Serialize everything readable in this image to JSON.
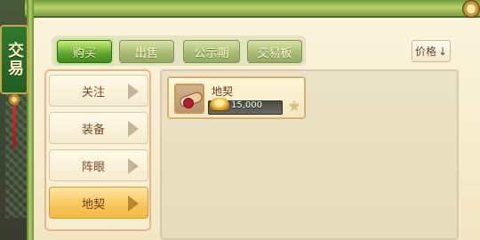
{
  "window": {
    "title": "交易"
  },
  "tabs": [
    {
      "label": "购买",
      "active": true
    },
    {
      "label": "出售",
      "active": false
    },
    {
      "label": "公示期",
      "active": false
    },
    {
      "label": "交易板",
      "active": false
    }
  ],
  "sort": {
    "label": "价格",
    "direction_icon": "arrow-down-icon",
    "direction_glyph": "↓"
  },
  "categories": [
    {
      "label": "关注",
      "active": false
    },
    {
      "label": "装备",
      "active": false
    },
    {
      "label": "阵眼",
      "active": false
    },
    {
      "label": "地契",
      "active": true
    }
  ],
  "items": [
    {
      "name": "地契",
      "price": "15,000",
      "currency_icon": "gold-ingot-icon",
      "item_icon": "scroll-icon",
      "favorite_icon": "star-icon",
      "favorite_glyph": "★"
    }
  ],
  "colors": {
    "accent_green": "#5aa72e",
    "panel": "#f6eccc",
    "active_category": "#f7c85c",
    "title_tag": "#2f7a2f"
  }
}
